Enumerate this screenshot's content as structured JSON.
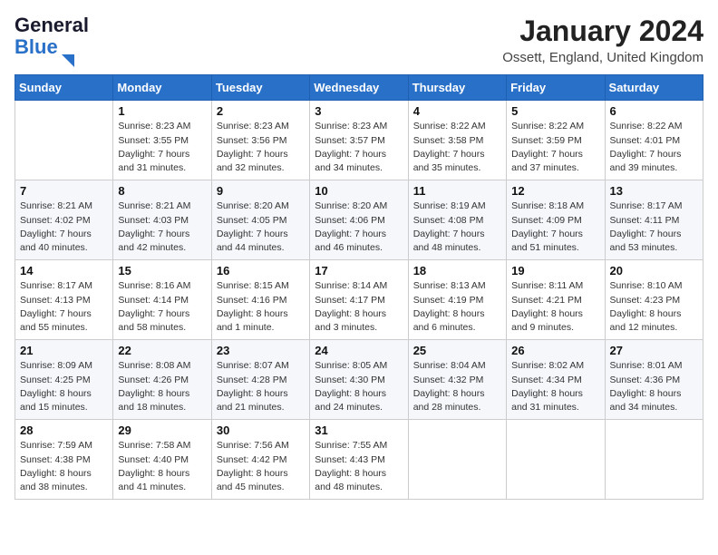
{
  "header": {
    "logo_line1": "General",
    "logo_line2": "Blue",
    "month_year": "January 2024",
    "location": "Ossett, England, United Kingdom"
  },
  "days_of_week": [
    "Sunday",
    "Monday",
    "Tuesday",
    "Wednesday",
    "Thursday",
    "Friday",
    "Saturday"
  ],
  "weeks": [
    [
      {
        "day": "",
        "info": ""
      },
      {
        "day": "1",
        "info": "Sunrise: 8:23 AM\nSunset: 3:55 PM\nDaylight: 7 hours\nand 31 minutes."
      },
      {
        "day": "2",
        "info": "Sunrise: 8:23 AM\nSunset: 3:56 PM\nDaylight: 7 hours\nand 32 minutes."
      },
      {
        "day": "3",
        "info": "Sunrise: 8:23 AM\nSunset: 3:57 PM\nDaylight: 7 hours\nand 34 minutes."
      },
      {
        "day": "4",
        "info": "Sunrise: 8:22 AM\nSunset: 3:58 PM\nDaylight: 7 hours\nand 35 minutes."
      },
      {
        "day": "5",
        "info": "Sunrise: 8:22 AM\nSunset: 3:59 PM\nDaylight: 7 hours\nand 37 minutes."
      },
      {
        "day": "6",
        "info": "Sunrise: 8:22 AM\nSunset: 4:01 PM\nDaylight: 7 hours\nand 39 minutes."
      }
    ],
    [
      {
        "day": "7",
        "info": "Sunrise: 8:21 AM\nSunset: 4:02 PM\nDaylight: 7 hours\nand 40 minutes."
      },
      {
        "day": "8",
        "info": "Sunrise: 8:21 AM\nSunset: 4:03 PM\nDaylight: 7 hours\nand 42 minutes."
      },
      {
        "day": "9",
        "info": "Sunrise: 8:20 AM\nSunset: 4:05 PM\nDaylight: 7 hours\nand 44 minutes."
      },
      {
        "day": "10",
        "info": "Sunrise: 8:20 AM\nSunset: 4:06 PM\nDaylight: 7 hours\nand 46 minutes."
      },
      {
        "day": "11",
        "info": "Sunrise: 8:19 AM\nSunset: 4:08 PM\nDaylight: 7 hours\nand 48 minutes."
      },
      {
        "day": "12",
        "info": "Sunrise: 8:18 AM\nSunset: 4:09 PM\nDaylight: 7 hours\nand 51 minutes."
      },
      {
        "day": "13",
        "info": "Sunrise: 8:17 AM\nSunset: 4:11 PM\nDaylight: 7 hours\nand 53 minutes."
      }
    ],
    [
      {
        "day": "14",
        "info": "Sunrise: 8:17 AM\nSunset: 4:13 PM\nDaylight: 7 hours\nand 55 minutes."
      },
      {
        "day": "15",
        "info": "Sunrise: 8:16 AM\nSunset: 4:14 PM\nDaylight: 7 hours\nand 58 minutes."
      },
      {
        "day": "16",
        "info": "Sunrise: 8:15 AM\nSunset: 4:16 PM\nDaylight: 8 hours\nand 1 minute."
      },
      {
        "day": "17",
        "info": "Sunrise: 8:14 AM\nSunset: 4:17 PM\nDaylight: 8 hours\nand 3 minutes."
      },
      {
        "day": "18",
        "info": "Sunrise: 8:13 AM\nSunset: 4:19 PM\nDaylight: 8 hours\nand 6 minutes."
      },
      {
        "day": "19",
        "info": "Sunrise: 8:11 AM\nSunset: 4:21 PM\nDaylight: 8 hours\nand 9 minutes."
      },
      {
        "day": "20",
        "info": "Sunrise: 8:10 AM\nSunset: 4:23 PM\nDaylight: 8 hours\nand 12 minutes."
      }
    ],
    [
      {
        "day": "21",
        "info": "Sunrise: 8:09 AM\nSunset: 4:25 PM\nDaylight: 8 hours\nand 15 minutes."
      },
      {
        "day": "22",
        "info": "Sunrise: 8:08 AM\nSunset: 4:26 PM\nDaylight: 8 hours\nand 18 minutes."
      },
      {
        "day": "23",
        "info": "Sunrise: 8:07 AM\nSunset: 4:28 PM\nDaylight: 8 hours\nand 21 minutes."
      },
      {
        "day": "24",
        "info": "Sunrise: 8:05 AM\nSunset: 4:30 PM\nDaylight: 8 hours\nand 24 minutes."
      },
      {
        "day": "25",
        "info": "Sunrise: 8:04 AM\nSunset: 4:32 PM\nDaylight: 8 hours\nand 28 minutes."
      },
      {
        "day": "26",
        "info": "Sunrise: 8:02 AM\nSunset: 4:34 PM\nDaylight: 8 hours\nand 31 minutes."
      },
      {
        "day": "27",
        "info": "Sunrise: 8:01 AM\nSunset: 4:36 PM\nDaylight: 8 hours\nand 34 minutes."
      }
    ],
    [
      {
        "day": "28",
        "info": "Sunrise: 7:59 AM\nSunset: 4:38 PM\nDaylight: 8 hours\nand 38 minutes."
      },
      {
        "day": "29",
        "info": "Sunrise: 7:58 AM\nSunset: 4:40 PM\nDaylight: 8 hours\nand 41 minutes."
      },
      {
        "day": "30",
        "info": "Sunrise: 7:56 AM\nSunset: 4:42 PM\nDaylight: 8 hours\nand 45 minutes."
      },
      {
        "day": "31",
        "info": "Sunrise: 7:55 AM\nSunset: 4:43 PM\nDaylight: 8 hours\nand 48 minutes."
      },
      {
        "day": "",
        "info": ""
      },
      {
        "day": "",
        "info": ""
      },
      {
        "day": "",
        "info": ""
      }
    ]
  ]
}
